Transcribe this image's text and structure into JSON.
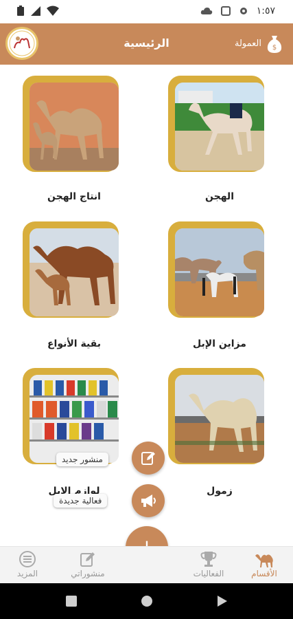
{
  "status": {
    "time": "١:٥٧"
  },
  "header": {
    "title": "الرئيسية",
    "commission_label": "العمولة"
  },
  "categories": [
    {
      "label": "الهجن"
    },
    {
      "label": "انتاج الهجن"
    },
    {
      "label": "مزاين الإبل"
    },
    {
      "label": "بقية الأنواع"
    },
    {
      "label": "زمول"
    },
    {
      "label": "لوازم الإبل"
    }
  ],
  "fab": {
    "new_post": "منشور جديد",
    "new_event": "فعالية جديدة",
    "add": "+"
  },
  "nav": {
    "sections": "الأقسام",
    "events": "الفعاليات",
    "my_posts": "منشوراتي",
    "more": "المزيد"
  },
  "colors": {
    "primary": "#c8895a",
    "frame_gold": "#d8ae3d"
  }
}
